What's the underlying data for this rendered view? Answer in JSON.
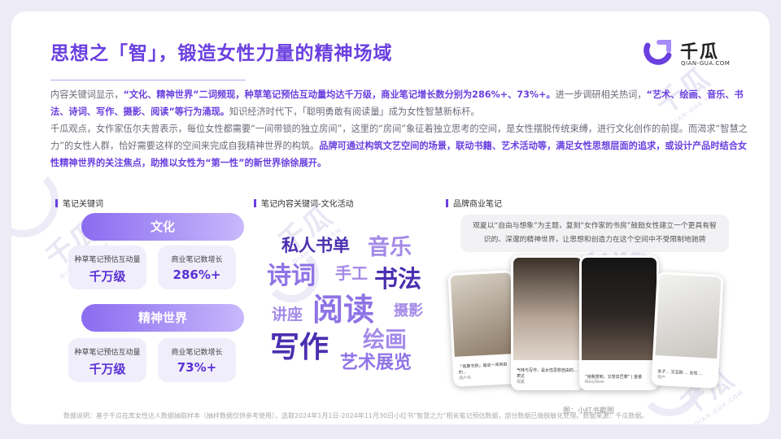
{
  "title": "思想之「智」，锻造女性力量的精神场域",
  "logo": {
    "name": "千瓜",
    "sub": "QIAN-GUA.COM"
  },
  "watermark": {
    "text": "千瓜",
    "sub": "QIAN-GUA.COM"
  },
  "paragraph1": {
    "p1": "内容关键词显示，",
    "b1": "“文化、精神世界”二词频现，种草笔记预估互动量均达千万级，商业笔记增长数分别为286%+、73%+。",
    "p2": "进一步调研相关热词，",
    "b2": "“艺术、绘画、音乐、书法、诗词、写作、摄影、阅读”等行为涌现。",
    "p3": "知识经济时代下，「聪明勇敢有阅读量」成为女性智慧新标杆。"
  },
  "paragraph2": {
    "p1": "千瓜观点，女作家伍尔夫曾表示，每位女性都需要“一间带锁的独立房间”，这里的“房间”象征着独立思考的空间，是女性摆脱传统束缚，进行文化创作的前提。而渴求“智慧之力”的女性人群，恰好需要这样的空间来完成自我精神世界的构筑。",
    "b1": "品牌可通过构筑文艺空间的场景，联动书籍、艺术活动等，满足女性思想层面的追求，或设计产品时结合女性精神世界的关注焦点，助推以女性为“第一性”的新世界徐徐展开。"
  },
  "sections": {
    "keywords": "笔记关键词",
    "cloud": "笔记内容关键词-文化活动",
    "brand": "品牌商业笔记"
  },
  "keyword_groups": [
    {
      "name": "文化",
      "stats": [
        {
          "label": "种草笔记预估互动量",
          "value": "千万级"
        },
        {
          "label": "商业笔记数增长",
          "value": "286%+"
        }
      ]
    },
    {
      "name": "精神世界",
      "stats": [
        {
          "label": "种草笔记预估互动量",
          "value": "千万级"
        },
        {
          "label": "商业笔记数增长",
          "value": "73%+"
        }
      ]
    }
  ],
  "word_cloud": [
    "私人书单",
    "音乐",
    "诗词",
    "手工",
    "书法",
    "讲座",
    "阅读",
    "摄影",
    "写作",
    "绘画",
    "艺术展览"
  ],
  "brand_quote": "观夏以“自由与想象”为主题，复刻“女作家的书房”鼓励女性建立一个更具有智识的、深邃的精神世界，让思想和创造力在这个空间中不受限制地驰骋",
  "phone_notes": [
    {
      "text": "「观夏书房」是这一间自由的...",
      "user": "用户名"
    },
    {
      "text": "气味与写作，是女性思想自由的... 表达",
      "user": "观夏"
    },
    {
      "text": "“她我想到，又想去巴黎” | 金装",
      "user": "RosySeas"
    },
    {
      "text": "女子... 交互剧 ... 女性 ...",
      "user": "用户"
    }
  ],
  "caption": "图：小红书截图",
  "footer": "数据说明：基于千瓜在库女性达人数据抽取样本（抽样数据仅供参考使用），选取2024年1月1日-2024年11月30日小红书“智慧之力”相关笔记预估数据，部分数据已做脱敏化处理。数据来源：千瓜数据。",
  "colors": {
    "accent": "#6a3fe0",
    "pill_start": "#8b6bf0",
    "pill_end": "#c8b8fb",
    "stat_bg": "#f1eefb"
  }
}
